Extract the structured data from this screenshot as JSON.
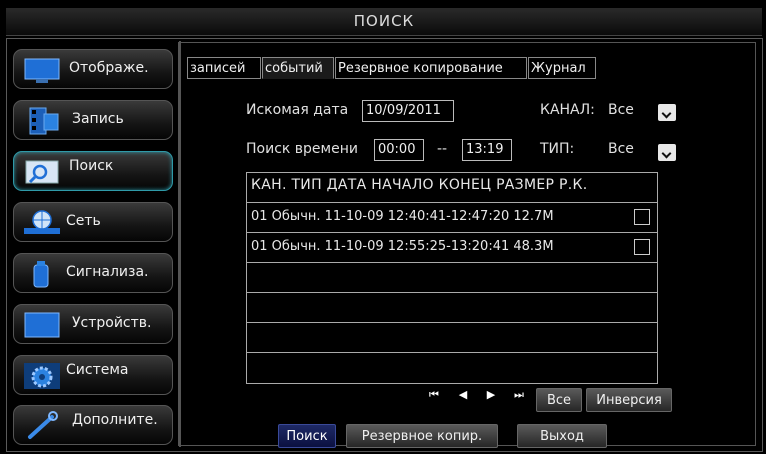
{
  "title": "ПОИСК",
  "sidebar": {
    "items": [
      {
        "label": "Отображе.",
        "icon": "monitor-icon"
      },
      {
        "label": "Запись",
        "icon": "film-icon"
      },
      {
        "label": "Поиск",
        "icon": "magnifier-icon",
        "active": true
      },
      {
        "label": "Сеть",
        "icon": "network-globe-icon"
      },
      {
        "label": "Сигнализа.",
        "icon": "alarm-siren-icon"
      },
      {
        "label": "Устройств.",
        "icon": "device-screen-icon"
      },
      {
        "label": "Система",
        "icon": "gear-icon"
      },
      {
        "label": "Дополните.",
        "icon": "wrench-icon"
      }
    ]
  },
  "tabs": [
    "записей",
    "событий",
    "Резервное копирование",
    "Журнал"
  ],
  "active_tab": "событий",
  "search": {
    "date_label": "Искомая дата",
    "date_value": "10/09/2011",
    "channel_label": "КАНАЛ:",
    "channel_value": "Все",
    "time_label": "Поиск времени",
    "time_from": "00:00",
    "time_sep": "--",
    "time_to": "13:19",
    "type_label": "ТИП:",
    "type_value": "Все"
  },
  "table": {
    "header": "КАН. ТИП ДАТА НАЧАЛО КОНЕЦ РАЗМЕР Р.К.",
    "rows": [
      "01 Обычн. 11-10-09 12:40:41-12:47:20 12.7M",
      "01 Обычн. 11-10-09 12:55:25-13:20:41 48.3M"
    ]
  },
  "pager": {
    "first": "⏮",
    "prev": "◀",
    "next": "▶",
    "last": "⏭",
    "all_label": "Все",
    "invert_label": "Инверсия"
  },
  "actions": {
    "search_label": "Поиск",
    "backup_label": "Резервное копир.",
    "exit_label": "Выход"
  },
  "colors": {
    "accent": "#2f9aa8",
    "active_button": "#1e2a66",
    "icon_blue": "#1f6fd6"
  }
}
